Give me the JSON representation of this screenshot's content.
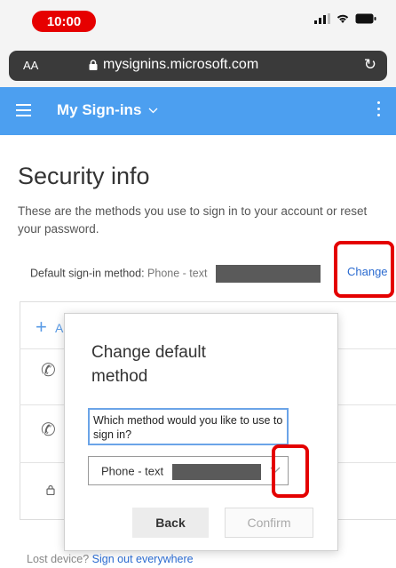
{
  "status": {
    "time": "10:00"
  },
  "browser": {
    "text_size_label": "AA",
    "url": "mysignins.microsoft.com"
  },
  "app": {
    "title": "My Sign-ins"
  },
  "page": {
    "title": "Security info",
    "description": "These are the methods you use to sign in to your account or reset your password.",
    "default_label": "Default sign-in method:",
    "default_value": "Phone - text",
    "change_link": "Change",
    "add_method_partial": "A"
  },
  "dialog": {
    "title": "Change default method",
    "question": "Which method would you like to use to sign in?",
    "selected_option": "Phone - text",
    "back_label": "Back",
    "confirm_label": "Confirm"
  },
  "footer": {
    "lost_text": "Lost device?",
    "sign_out_link": "Sign out everywhere"
  },
  "colors": {
    "header": "#4c9ff0",
    "accent": "#2b6bd0",
    "highlight": "#e40000",
    "time_pill": "#e60000"
  },
  "icons": [
    "signal-icon",
    "wifi-icon",
    "battery-icon",
    "lock-icon",
    "reload-icon",
    "hamburger-icon",
    "chevron-down-icon",
    "more-vertical-icon",
    "plus-icon",
    "phone-icon",
    "password-lock-icon"
  ]
}
